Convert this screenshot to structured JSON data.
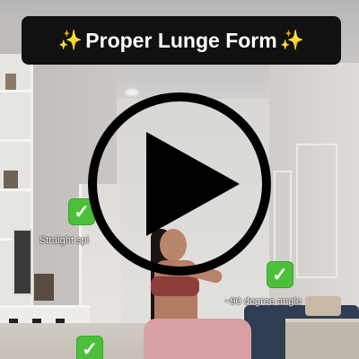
{
  "video": {
    "title": "Proper Lunge Form",
    "title_emoji": "✨",
    "annotations": [
      {
        "check": "✓",
        "label": "Straight spi"
      },
      {
        "check": "✓",
        "label": "~90 degree angle"
      },
      {
        "check": "✓",
        "label": ""
      }
    ],
    "play_button_icon": "play-icon",
    "colors": {
      "banner_bg": "#111111",
      "title_text": "#ffffff",
      "check_bg": "#4cc03a",
      "play_icon": "#000000"
    }
  }
}
